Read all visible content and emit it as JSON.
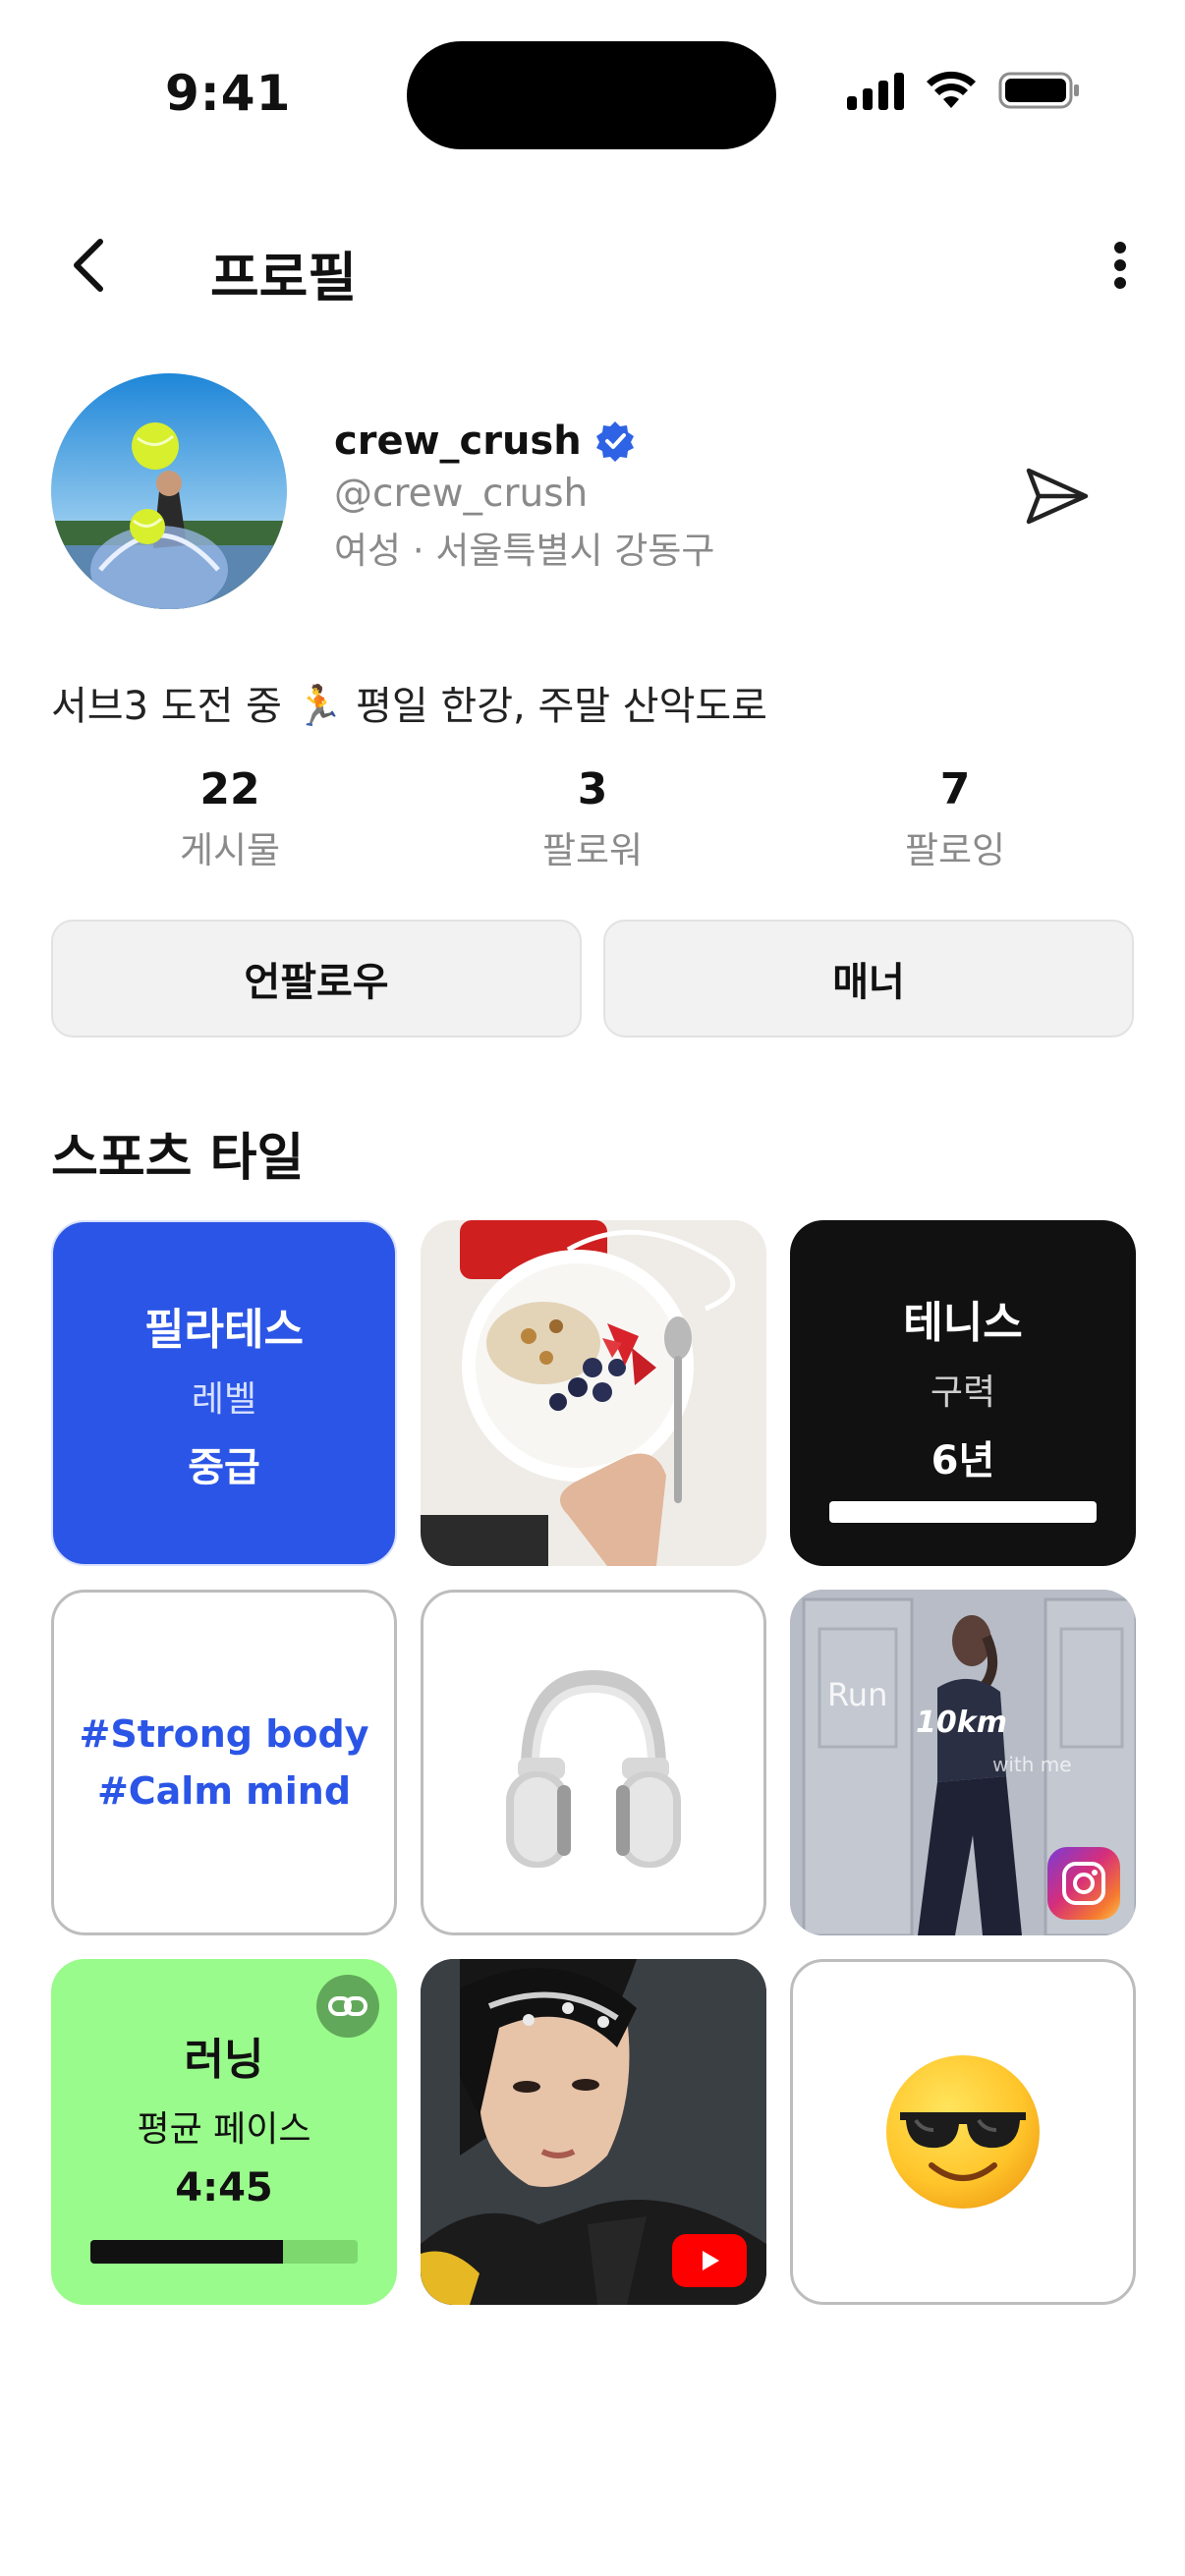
{
  "status_bar": {
    "time": "9:41"
  },
  "nav": {
    "title": "프로필"
  },
  "profile": {
    "username": "crew_crush",
    "handle": "@crew_crush",
    "meta": "여성 · 서울특별시 강동구",
    "bio": "서브3 도전 중 🏃  평일 한강, 주말 산악도로"
  },
  "stats": [
    {
      "value": "22",
      "label": "게시물"
    },
    {
      "value": "3",
      "label": "팔로워"
    },
    {
      "value": "7",
      "label": "팔로잉"
    }
  ],
  "actions": {
    "unfollow_label": "언팔로우",
    "manner_label": "매너"
  },
  "section": {
    "title": "스포츠 타일"
  },
  "tiles": {
    "pilates": {
      "sport": "필라테스",
      "label": "레벨",
      "value": "중급",
      "color": "#2b55e6"
    },
    "tennis": {
      "sport": "테니스",
      "label": "구력",
      "value": "6년",
      "progress": 1.0
    },
    "tags": {
      "line1": "#Strong body",
      "line2": "#Calm mind",
      "color": "#2b55e6"
    },
    "reel": {
      "text1": "Run",
      "text2": "10km",
      "text3": "with me"
    },
    "running": {
      "sport": "러닝",
      "label": "평균 페이스",
      "value": "4:45",
      "progress": 0.72,
      "color": "#99fb8b"
    },
    "emoji": {
      "glyph": "😎"
    }
  },
  "icons": [
    "back-arrow-icon",
    "more-vertical-icon",
    "verified-badge-icon",
    "send-icon",
    "link-icon",
    "instagram-icon",
    "youtube-icon",
    "headphones-icon"
  ]
}
